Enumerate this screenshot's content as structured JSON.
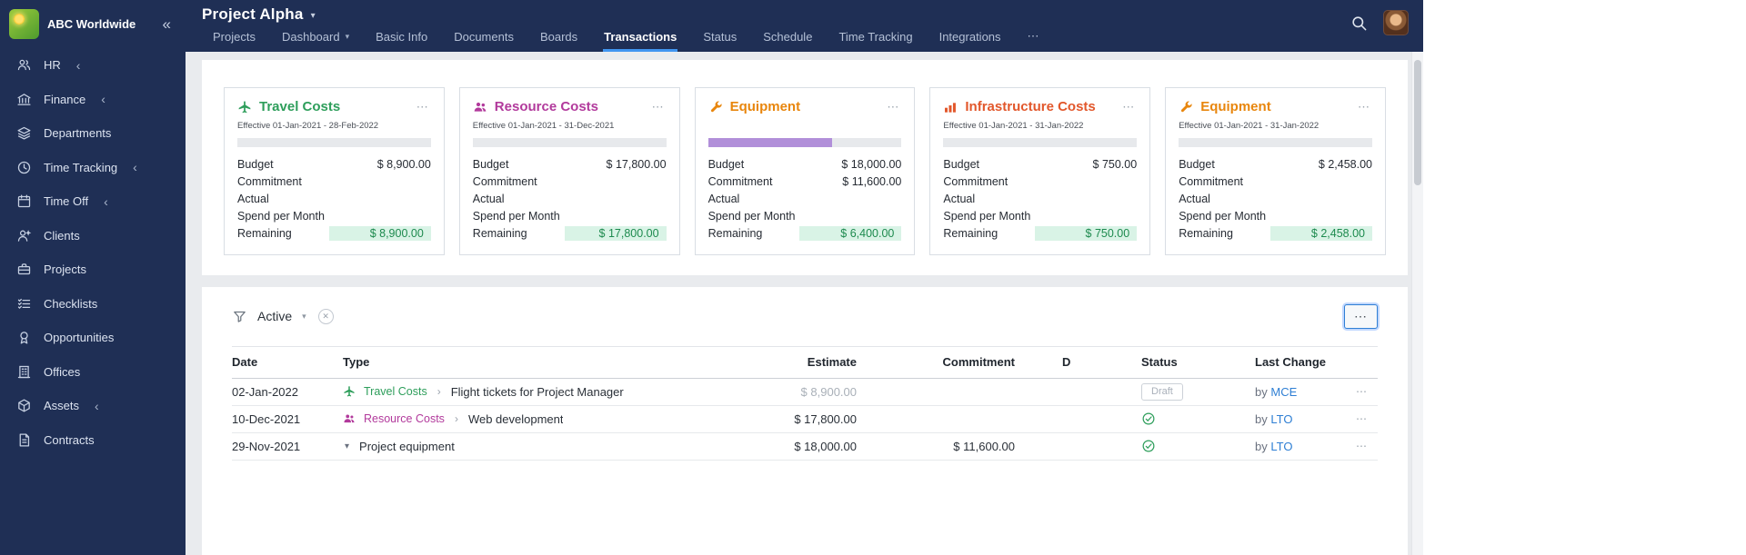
{
  "glyphs": {
    "more": "⋯",
    "collapse": "«",
    "submenu": "‹",
    "caret_down": "▾",
    "sep": "›",
    "clear": "✕"
  },
  "header": {
    "company": "ABC Worldwide",
    "title": "Project Alpha"
  },
  "colors": {
    "navy": "#1f2f55",
    "tab_underline": "#4196f0",
    "green": "#2e9e5b",
    "magenta": "#b23a9c",
    "orange": "#e8860d",
    "red_orange": "#e2572b",
    "remaining_bg": "#d9f3e6",
    "remaining_text": "#1d8a4e",
    "progress_fill": "#b18fd9",
    "link_blue": "#2f7fd4"
  },
  "sidebar": {
    "items": [
      {
        "label": "HR",
        "icon": "people-icon",
        "expandable": true
      },
      {
        "label": "Finance",
        "icon": "bank-icon",
        "expandable": true
      },
      {
        "label": "Departments",
        "icon": "layers-icon",
        "expandable": false
      },
      {
        "label": "Time Tracking",
        "icon": "clock-icon",
        "expandable": true
      },
      {
        "label": "Time Off",
        "icon": "calendar-icon",
        "expandable": true
      },
      {
        "label": "Clients",
        "icon": "client-icon",
        "expandable": false
      },
      {
        "label": "Projects",
        "icon": "briefcase-icon",
        "expandable": false
      },
      {
        "label": "Checklists",
        "icon": "checklist-icon",
        "expandable": false
      },
      {
        "label": "Opportunities",
        "icon": "medal-icon",
        "expandable": false
      },
      {
        "label": "Offices",
        "icon": "building-icon",
        "expandable": false
      },
      {
        "label": "Assets",
        "icon": "box-icon",
        "expandable": true
      },
      {
        "label": "Contracts",
        "icon": "document-icon",
        "expandable": false
      }
    ]
  },
  "tabs": [
    {
      "label": "Projects"
    },
    {
      "label": "Dashboard"
    },
    {
      "label": "Basic Info"
    },
    {
      "label": "Documents"
    },
    {
      "label": "Boards"
    },
    {
      "label": "Transactions"
    },
    {
      "label": "Status"
    },
    {
      "label": "Schedule"
    },
    {
      "label": "Time Tracking"
    },
    {
      "label": "Integrations"
    }
  ],
  "card_labels": {
    "budget": "Budget",
    "commitment": "Commitment",
    "actual": "Actual",
    "spend": "Spend per Month",
    "remaining": "Remaining"
  },
  "cards": [
    {
      "name": "Travel Costs",
      "icon": "plane-icon",
      "color": "#2e9e5b",
      "effective": "Effective 01-Jan-2021 - 28-Feb-2022",
      "progress": "0%",
      "budget": "$ 8,900.00",
      "commitment": "",
      "actual": "",
      "spend": "",
      "remaining": "$ 8,900.00"
    },
    {
      "name": "Resource Costs",
      "icon": "people-icon",
      "color": "#b23a9c",
      "effective": "Effective 01-Jan-2021 - 31-Dec-2021",
      "progress": "0%",
      "budget": "$ 17,800.00",
      "commitment": "",
      "actual": "",
      "spend": "",
      "remaining": "$ 17,800.00"
    },
    {
      "name": "Equipment",
      "icon": "wrench-icon",
      "color": "#e8860d",
      "effective": "",
      "progress": "64%",
      "budget": "$ 18,000.00",
      "commitment": "$ 11,600.00",
      "actual": "",
      "spend": "",
      "remaining": "$ 6,400.00"
    },
    {
      "name": "Infrastructure Costs",
      "icon": "bars-icon",
      "color": "#e2572b",
      "effective": "Effective 01-Jan-2021 - 31-Jan-2022",
      "progress": "0%",
      "budget": "$ 750.00",
      "commitment": "",
      "actual": "",
      "spend": "",
      "remaining": "$ 750.00"
    },
    {
      "name": "Equipment",
      "icon": "wrench-icon",
      "color": "#e8860d",
      "effective": "Effective 01-Jan-2021 - 31-Jan-2022",
      "progress": "0%",
      "budget": "$ 2,458.00",
      "commitment": "",
      "actual": "",
      "spend": "",
      "remaining": "$ 2,458.00"
    }
  ],
  "filter": {
    "label": "Active"
  },
  "table": {
    "headers": [
      "Date",
      "Type",
      "Estimate",
      "Commitment",
      "D",
      "Status",
      "Last Change"
    ],
    "by_label": "by",
    "rows": [
      {
        "date": "02-Jan-2022",
        "type": "Travel Costs",
        "type_color": "#2e9e5b",
        "type_icon": "plane-icon",
        "description": "Flight tickets for Project Manager",
        "estimate": "$ 8,900.00",
        "commitment": "",
        "status_badge": "Draft",
        "user": "MCE"
      },
      {
        "date": "10-Dec-2021",
        "type": "Resource Costs",
        "type_color": "#b23a9c",
        "type_icon": "people-icon",
        "description": "Web development",
        "estimate": "$ 17,800.00",
        "commitment": "",
        "status_badge": "",
        "user": "LTO"
      },
      {
        "date": "29-Nov-2021",
        "type": "",
        "type_color": "",
        "type_icon": "caret-down-icon",
        "description": "Project equipment",
        "estimate": "$ 18,000.00",
        "commitment": "$ 11,600.00",
        "status_badge": "",
        "user": "LTO"
      }
    ]
  }
}
